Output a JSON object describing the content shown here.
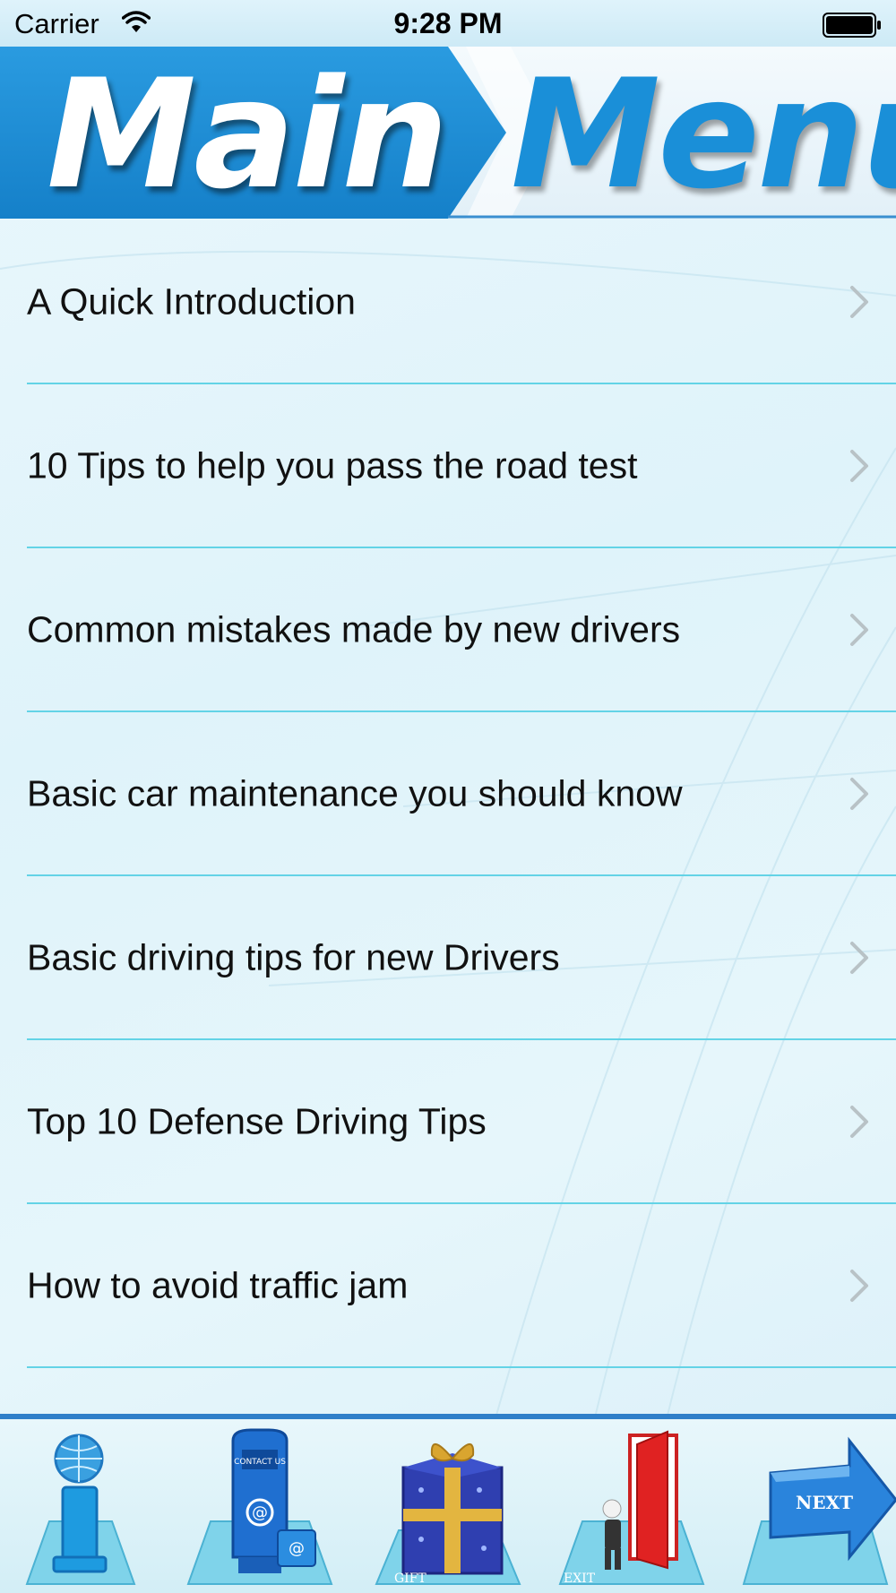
{
  "status_bar": {
    "carrier": "Carrier",
    "time": "9:28 PM"
  },
  "header": {
    "title_part1": "Main",
    "title_part2": "Menu"
  },
  "menu": {
    "items": [
      {
        "label": "A Quick Introduction"
      },
      {
        "label": "10 Tips to help you pass the road test"
      },
      {
        "label": "Common mistakes made by new drivers"
      },
      {
        "label": "Basic car maintenance you should know"
      },
      {
        "label": "Basic driving tips for new Drivers"
      },
      {
        "label": "Top 10 Defense Driving Tips"
      },
      {
        "label": "How to avoid traffic jam"
      }
    ]
  },
  "toolbar": {
    "contact_label": "CONTACT US",
    "gift_label": "GIFT",
    "exit_label": "EXIT",
    "next_label": "NEXT"
  },
  "colors": {
    "accent": "#1a8fd8",
    "divider": "#63d3e6",
    "toolbar_border": "#2f7fc9"
  }
}
